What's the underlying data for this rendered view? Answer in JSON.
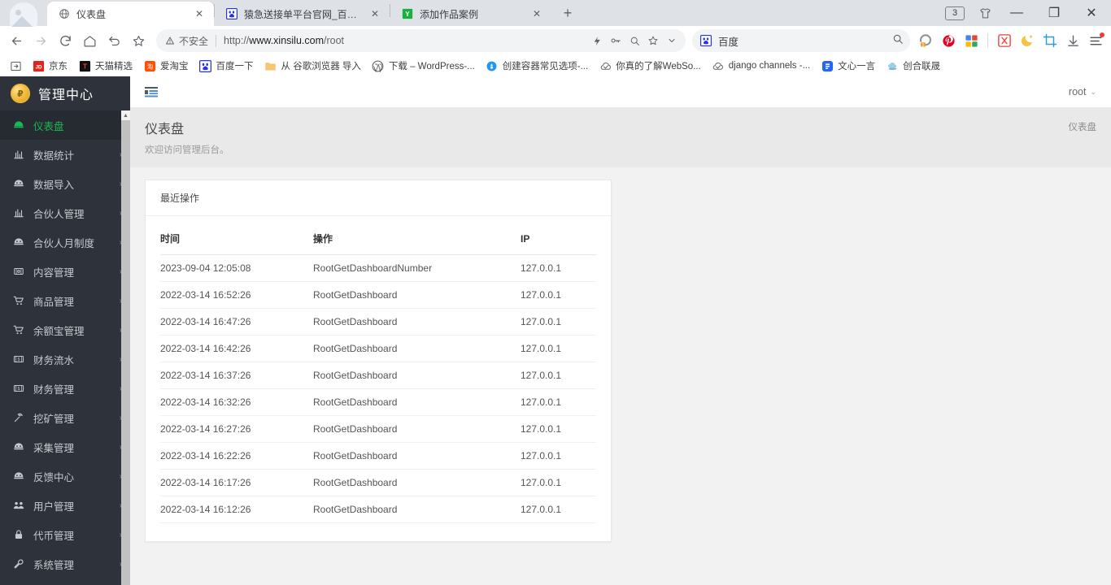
{
  "browser": {
    "tabs": [
      {
        "title": "仪表盘",
        "favicon": "globe-icon",
        "active": true
      },
      {
        "title": "猿急送接单平台官网_百度搜索",
        "favicon": "baidu-icon",
        "active": false
      },
      {
        "title": "添加作品案例",
        "favicon": "y-green-icon",
        "active": false
      }
    ],
    "new_tab_label": "+",
    "tab_count_badge": "3",
    "window_controls": {
      "minimize": "—",
      "maximize": "❐",
      "close": "✕"
    },
    "nav": {
      "back": "back-icon",
      "forward": "forward-icon",
      "reload": "reload-icon",
      "home": "home-icon",
      "undo": "undo-icon",
      "star": "star-icon"
    },
    "omnibox": {
      "security_label": "不安全",
      "url_scheme": "http://",
      "url_host": "www.xinsilu.com",
      "url_path": "/root",
      "right_icons": [
        "lightning-icon",
        "key-icon",
        "zoom-search-icon",
        "bookmark-star-icon",
        "chevron-down-icon"
      ]
    },
    "searchbox": {
      "engine_label": "百度",
      "icon": "baidu-icon",
      "search_icon": "search-icon"
    },
    "extensions": [
      "extension-puzzle-icon",
      "pinterest-icon",
      "apps-grid-icon",
      "pdf-icon",
      "dark-mode-moon-icon",
      "screenshot-crop-icon",
      "download-icon",
      "menu-icon"
    ],
    "bookmarks": [
      {
        "label": "",
        "icon": "import-bookmark-icon"
      },
      {
        "label": "京东",
        "icon": "jd-icon"
      },
      {
        "label": "天猫精选",
        "icon": "tmall-icon"
      },
      {
        "label": "爱淘宝",
        "icon": "taobao-icon"
      },
      {
        "label": "百度一下",
        "icon": "baidu-icon"
      },
      {
        "label": "从 谷歌浏览器 导入",
        "icon": "folder-icon"
      },
      {
        "label": "下载 – WordPress-...",
        "icon": "wordpress-icon"
      },
      {
        "label": "创建容器常见选项-...",
        "icon": "blue-dot-icon"
      },
      {
        "label": "你真的了解WebSo...",
        "icon": "doc-icon"
      },
      {
        "label": "django channels -...",
        "icon": "doc-icon"
      },
      {
        "label": "文心一言",
        "icon": "ernie-icon"
      },
      {
        "label": "创合联晟",
        "icon": "cloud-icon"
      }
    ]
  },
  "sidebar": {
    "brand": "管理中心",
    "brand_icon": "gold-coin-icon",
    "items": [
      {
        "label": "仪表盘",
        "icon": "dashboard-icon",
        "arrow": "",
        "active": true
      },
      {
        "label": "数据统计",
        "icon": "bar-chart-icon",
        "arrow": "›",
        "active": false
      },
      {
        "label": "数据导入",
        "icon": "import-data-icon",
        "arrow": "›",
        "active": false
      },
      {
        "label": "合伙人管理",
        "icon": "bar-chart-icon",
        "arrow": "›",
        "active": false
      },
      {
        "label": "合伙人月制度",
        "icon": "calendar-icon",
        "arrow": "›",
        "active": false
      },
      {
        "label": "内容管理",
        "icon": "content-icon",
        "arrow": "›",
        "active": false
      },
      {
        "label": "商品管理",
        "icon": "cart-icon",
        "arrow": "›",
        "active": false
      },
      {
        "label": "余额宝管理",
        "icon": "cart-icon",
        "arrow": "›",
        "active": false
      },
      {
        "label": "财务流水",
        "icon": "money-icon",
        "arrow": "›",
        "active": false
      },
      {
        "label": "财务管理",
        "icon": "money-icon",
        "arrow": "›",
        "active": false
      },
      {
        "label": "挖矿管理",
        "icon": "pickaxe-icon",
        "arrow": "›",
        "active": false
      },
      {
        "label": "采集管理",
        "icon": "spider-icon",
        "arrow": "›",
        "active": false
      },
      {
        "label": "反馈中心",
        "icon": "feedback-icon",
        "arrow": "›",
        "active": false
      },
      {
        "label": "用户管理",
        "icon": "users-icon",
        "arrow": "›",
        "active": false
      },
      {
        "label": "代币管理",
        "icon": "lock-icon",
        "arrow": "›",
        "active": false
      },
      {
        "label": "系统管理",
        "icon": "wrench-icon",
        "arrow": "›",
        "active": false
      }
    ]
  },
  "topbar": {
    "toggle_icon": "sidebar-list-icon",
    "user": "root",
    "user_caret": "⌄"
  },
  "pagehead": {
    "title": "仪表盘",
    "subtitle": "欢迎访问管理后台。",
    "breadcrumb": "仪表盘"
  },
  "card": {
    "title": "最近操作",
    "columns": [
      "时间",
      "操作",
      "IP"
    ],
    "rows": [
      [
        "2023-09-04 12:05:08",
        "RootGetDashboardNumber",
        "127.0.0.1"
      ],
      [
        "2022-03-14 16:52:26",
        "RootGetDashboard",
        "127.0.0.1"
      ],
      [
        "2022-03-14 16:47:26",
        "RootGetDashboard",
        "127.0.0.1"
      ],
      [
        "2022-03-14 16:42:26",
        "RootGetDashboard",
        "127.0.0.1"
      ],
      [
        "2022-03-14 16:37:26",
        "RootGetDashboard",
        "127.0.0.1"
      ],
      [
        "2022-03-14 16:32:26",
        "RootGetDashboard",
        "127.0.0.1"
      ],
      [
        "2022-03-14 16:27:26",
        "RootGetDashboard",
        "127.0.0.1"
      ],
      [
        "2022-03-14 16:22:26",
        "RootGetDashboard",
        "127.0.0.1"
      ],
      [
        "2022-03-14 16:17:26",
        "RootGetDashboard",
        "127.0.0.1"
      ],
      [
        "2022-03-14 16:12:26",
        "RootGetDashboard",
        "127.0.0.1"
      ]
    ]
  },
  "colors": {
    "sidebar_bg": "#2e323a",
    "sidebar_active_bg": "#262a31",
    "accent_green": "#19b955",
    "page_bg": "#f2f2f2",
    "pagehead_bg": "#e9e9e9",
    "card_bg": "#ffffff"
  }
}
